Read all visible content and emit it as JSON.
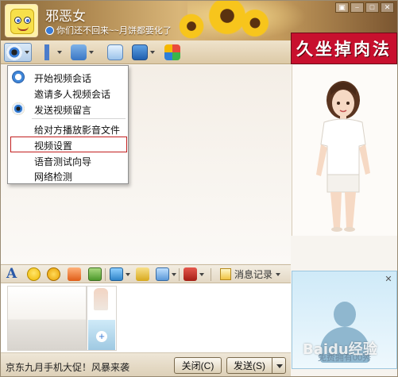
{
  "header": {
    "contact_name": "邪恶女",
    "signature": "你们还不回来~~月饼都要化了",
    "window_controls": [
      "▣",
      "⎯",
      "□",
      "✕"
    ]
  },
  "banner": {
    "text": "久坐掉肉法"
  },
  "toolbar": {
    "buttons": [
      {
        "name": "video",
        "icon": "camera-icon",
        "has_dropdown": true,
        "active": true
      },
      {
        "name": "voice",
        "icon": "microphone-icon",
        "has_dropdown": true
      },
      {
        "name": "file-transfer",
        "icon": "folder-icon",
        "has_dropdown": true
      },
      {
        "name": "message",
        "icon": "message-icon",
        "has_dropdown": false
      },
      {
        "name": "remote-assist",
        "icon": "screen-icon",
        "has_dropdown": true
      },
      {
        "name": "apps",
        "icon": "apps-icon",
        "has_dropdown": false
      }
    ]
  },
  "video_menu": {
    "items": [
      {
        "label": "开始视频会话",
        "icon": "chat-bubble-icon"
      },
      {
        "label": "邀请多人视频会话",
        "icon": ""
      },
      {
        "label": "发送视频留言",
        "icon": "camera-icon"
      },
      {
        "label": "给对方播放影音文件",
        "icon": ""
      },
      {
        "label": "视频设置",
        "icon": "",
        "highlighted": true
      },
      {
        "label": "语音测试向导",
        "icon": ""
      },
      {
        "label": "网络检测",
        "icon": ""
      }
    ]
  },
  "input_toolbar": {
    "history_label": "消息记录",
    "history_has_dropdown": true
  },
  "video_panel": {
    "caption": "免费拥有00秀",
    "close_glyph": "✕"
  },
  "watermark": {
    "text": "Baidu经验"
  },
  "footer": {
    "promo_text": "京东九月手机大促！风暴来袭",
    "close_button": "关闭(C)",
    "send_button": "发送(S)"
  },
  "colors": {
    "banner_red": "#c8102e",
    "toolbar_active": "#b4cde8",
    "menu_highlight": "#c21f1f"
  }
}
